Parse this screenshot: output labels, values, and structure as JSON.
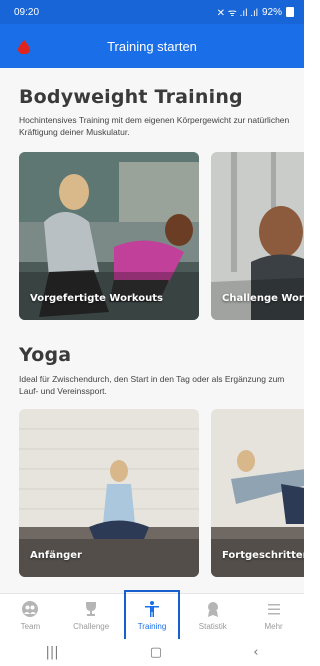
{
  "status": {
    "time": "09:20",
    "battery": "92%"
  },
  "appbar": {
    "title": "Training starten"
  },
  "sections": [
    {
      "title": "Bodyweight Training",
      "description": "Hochintensives Training mit dem eigenen Körpergewicht zur natürlichen Kräftigung deiner Muskulatur.",
      "cards": [
        {
          "label": "Vorgefertigte Workouts"
        },
        {
          "label": "Challenge Work"
        }
      ]
    },
    {
      "title": "Yoga",
      "description": "Ideal für Zwischendurch, den Start in den Tag oder als Ergänzung zum Lauf- und Vereinssport.",
      "cards": [
        {
          "label": "Anfänger"
        },
        {
          "label": "Fortgeschritten"
        }
      ]
    }
  ],
  "bottomnav": [
    {
      "label": "Team",
      "icon": "team-icon"
    },
    {
      "label": "Challenge",
      "icon": "trophy-icon"
    },
    {
      "label": "Training",
      "icon": "person-icon",
      "active": true
    },
    {
      "label": "Statistik",
      "icon": "medal-icon"
    },
    {
      "label": "Mehr",
      "icon": "menu-icon"
    }
  ],
  "colors": {
    "primary": "#1a6fe8",
    "statusbar": "#1765d6",
    "accent_red": "#e0241b"
  }
}
